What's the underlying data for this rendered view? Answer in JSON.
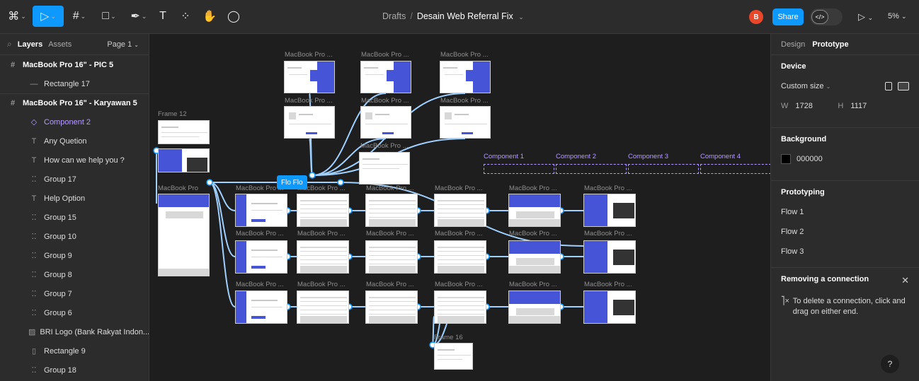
{
  "toolbar": {
    "breadcrumb_parent": "Drafts",
    "breadcrumb_sep": "/",
    "file_name": "Desain Web Referral Fix",
    "avatar_initial": "B",
    "share_label": "Share",
    "zoom": "5%",
    "accent": "#0d99ff"
  },
  "left_panel": {
    "tab_layers": "Layers",
    "tab_assets": "Assets",
    "page": "Page 1",
    "layers": [
      {
        "label": "MacBook Pro 16\" - PIC 5",
        "kind": "frame",
        "icon": "frame-icon"
      },
      {
        "label": "Rectangle 17",
        "kind": "child",
        "icon": "line-icon"
      },
      {
        "label": "MacBook Pro 16\" - Karyawan 5",
        "kind": "frame",
        "icon": "frame-icon"
      },
      {
        "label": "Component 2",
        "kind": "component",
        "icon": "instance-icon"
      },
      {
        "label": "Any Quetion",
        "kind": "child",
        "icon": "text-icon"
      },
      {
        "label": "How can we help you ?",
        "kind": "child",
        "icon": "text-icon"
      },
      {
        "label": "Group 17",
        "kind": "child",
        "icon": "group-icon"
      },
      {
        "label": "Help Option",
        "kind": "child",
        "icon": "text-icon"
      },
      {
        "label": "Group 15",
        "kind": "child",
        "icon": "group-icon"
      },
      {
        "label": "Group 10",
        "kind": "child",
        "icon": "group-icon"
      },
      {
        "label": "Group 9",
        "kind": "child",
        "icon": "group-icon"
      },
      {
        "label": "Group 8",
        "kind": "child",
        "icon": "group-icon"
      },
      {
        "label": "Group 7",
        "kind": "child",
        "icon": "group-icon"
      },
      {
        "label": "Group 6",
        "kind": "child",
        "icon": "group-icon"
      },
      {
        "label": "BRI Logo (Bank Rakyat Indon...",
        "kind": "child",
        "icon": "image-icon"
      },
      {
        "label": "Rectangle 9",
        "kind": "child",
        "icon": "rectangle-icon"
      },
      {
        "label": "Group 18",
        "kind": "child",
        "icon": "group-icon"
      }
    ]
  },
  "canvas": {
    "frame_label_macbook": "MacBook Pro ...",
    "frame_label_macbook_short": "MacBook Pro",
    "frame12": "Frame 12",
    "frame16": "Frame 16",
    "components": [
      "Component 1",
      "Component 2",
      "Component 3",
      "Component 4"
    ],
    "flow_chip": "Flo Flo"
  },
  "right_panel": {
    "tab_design": "Design",
    "tab_prototype": "Prototype",
    "device_title": "Device",
    "device_size": "Custom size",
    "w_label": "W",
    "w_value": "1728",
    "h_label": "H",
    "h_value": "1117",
    "background_title": "Background",
    "background_value": "000000",
    "prototyping_title": "Prototyping",
    "flows": [
      "Flow 1",
      "Flow 2",
      "Flow 3"
    ],
    "removing_title": "Removing a connection",
    "removing_text": "To delete a connection, click and drag on either end."
  }
}
